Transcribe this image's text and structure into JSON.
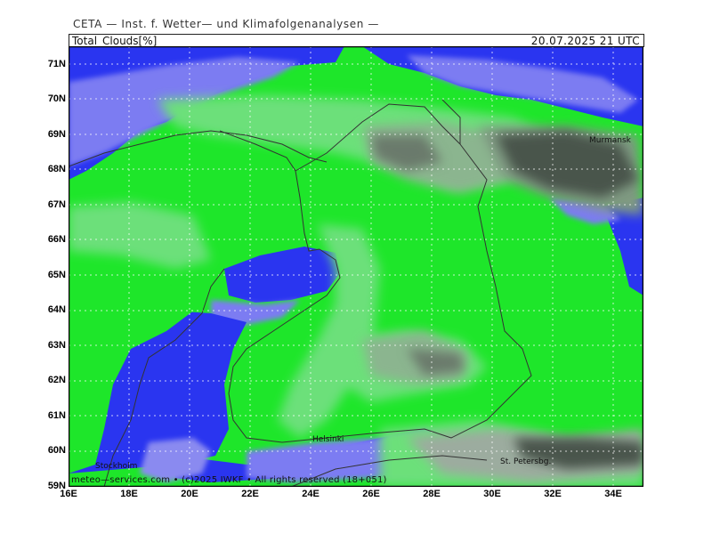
{
  "header": {
    "institute": "CETA — Inst. f. Wetter— und Klimafolgenanalysen —",
    "parameter": "Total_Clouds[%]",
    "datetime": "20.07.2025  21 UTC"
  },
  "map": {
    "lat_labels": [
      "71N",
      "70N",
      "69N",
      "68N",
      "67N",
      "66N",
      "65N",
      "64N",
      "63N",
      "62N",
      "61N",
      "60N",
      "59N"
    ],
    "lon_labels": [
      "16E",
      "18E",
      "20E",
      "22E",
      "24E",
      "26E",
      "28E",
      "30E",
      "32E",
      "34E"
    ],
    "cities": {
      "murmansk": "Murmansk",
      "helsinki": "Helsinki",
      "stockholm": "Stockholm",
      "st_petersburg": "St. Petersbg."
    },
    "colors": {
      "clear_blue": "#2a35f0",
      "light_blue": "#7c7cf2",
      "green": "#1ee62a",
      "light_green": "#6ce07a",
      "grey_green": "#8bb58f",
      "dark_grey": "#3f4a40"
    }
  },
  "footer": {
    "credit": "meteo—services.com • (c)2025 IWKF • All rights reserved (18+051)"
  }
}
